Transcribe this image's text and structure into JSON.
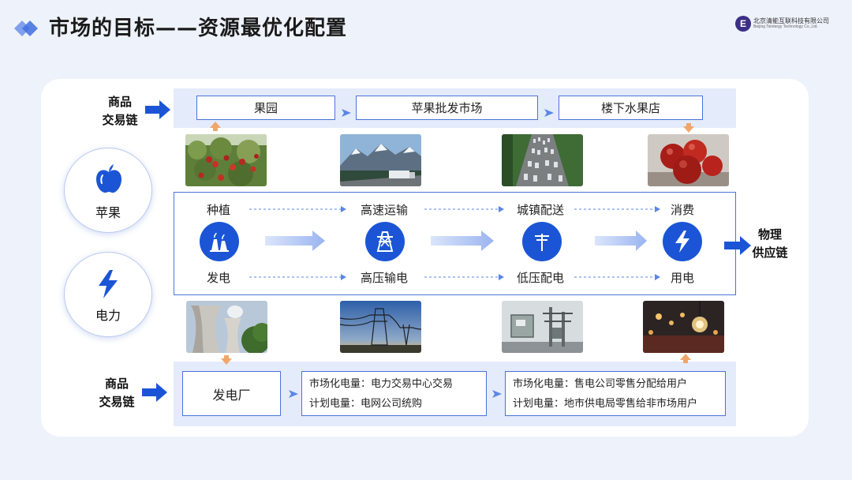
{
  "header": {
    "title": "市场的目标——资源最优化配置",
    "logo_cn": "北京清能互联科技有限公司",
    "logo_en": "Beijing Tsintergy Technology Co.,Ltd."
  },
  "colors": {
    "accent": "#1b55d6",
    "band": "#e4ebfb",
    "border": "#4a73d8",
    "orange": "#f0a66a"
  },
  "left_labels": {
    "top": [
      "商品",
      "交易链"
    ],
    "bottom": [
      "商品",
      "交易链"
    ]
  },
  "right_label": [
    "物理",
    "供应链"
  ],
  "circles": [
    {
      "label": "苹果",
      "icon": "apple-icon"
    },
    {
      "label": "电力",
      "icon": "lightning-icon"
    }
  ],
  "top_chain": [
    "果园",
    "苹果批发市场",
    "楼下水果店"
  ],
  "photos_top": [
    "apple-orchard-photo",
    "highway-truck-photo",
    "traffic-jam-photo",
    "red-apples-photo"
  ],
  "photos_bottom": [
    "cooling-tower-photo",
    "transmission-tower-photo",
    "transformer-photo",
    "light-bulb-photo"
  ],
  "flow": {
    "top_row": [
      "种植",
      "高速运输",
      "城镇配送",
      "消费"
    ],
    "bottom_row": [
      "发电",
      "高压输电",
      "低压配电",
      "用电"
    ],
    "nodes": [
      "power-plant-icon",
      "transmission-tower-icon",
      "utility-pole-icon",
      "lightning-icon"
    ]
  },
  "bottom_chain": {
    "plant": "发电厂",
    "mid": [
      "市场化电量：电力交易中心交易",
      "计划电量：电网公司统购"
    ],
    "right": [
      "市场化电量：售电公司零售分配给用户",
      "计划电量：地市供电局零售给非市场用户"
    ]
  }
}
